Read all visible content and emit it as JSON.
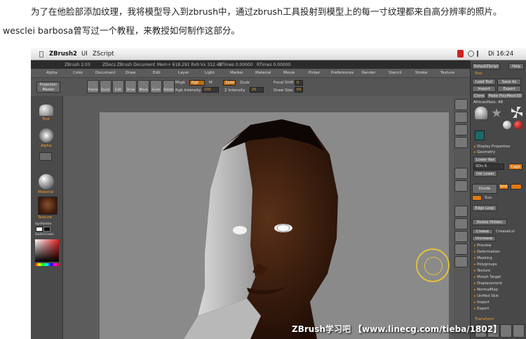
{
  "article": {
    "line1": "为了在他脸部添加纹理，我将模型导入到zbrush中，通过zbrush工具投射到模型上的每一寸纹理都来自高分辨率的照片。",
    "line2": "wesclei barbosa曾写过一个教程，来教授如何制作这部分。"
  },
  "macbar": {
    "app": "ZBrush2",
    "menu_ui": "UI",
    "menu_zscript": "ZScript",
    "clock": "Di 16:24"
  },
  "zbrush_header": {
    "title": "ZBrush 2.03",
    "doc": "ZDocs ZBrush Document",
    "mem": "Mem+ 618.291 Rx9 Vx 312.49",
    "ztimes": "ZTimes 0.00000",
    "rtimes": "RTimes 0.00000"
  },
  "menus": [
    "Alpha",
    "Color",
    "Document",
    "Draw",
    "Edit",
    "Layer",
    "Light",
    "Marker",
    "Material",
    "Movie",
    "Picker",
    "Preferences",
    "Render",
    "Stencil",
    "Stroke",
    "Texture"
  ],
  "toolbar": {
    "projection_master": "Projection Master",
    "tools": [
      "Frame",
      "Quick",
      "Edit",
      "Draw",
      "Move",
      "Scale",
      "Rotate"
    ],
    "mrgb": "Mrgb",
    "rgb": "Rgb",
    "m": "M",
    "rgb_intensity_label": "Rgb Intensity",
    "rgb_intensity": "100",
    "zadd": "Zadd",
    "zsub": "Zsub",
    "z_intensity_label": "Z Intensity",
    "z_intensity": "25",
    "focal_shift_label": "Focal Shift",
    "focal_shift": "0",
    "draw_size_label": "Draw Size",
    "draw_size": "64"
  },
  "left_panel": {
    "tool": "Tool",
    "alpha": "Alpha",
    "material": "Material",
    "texture": "Texture",
    "syspalette": "SysPalette",
    "switchcolor": "SwitchColor"
  },
  "right_tools": [
    "Scroll",
    "Zoom",
    "Actual",
    "AAHalf",
    "Pf Sur",
    "Local",
    "Move",
    "Scale",
    "Rotate",
    "Spin"
  ],
  "right_panel": {
    "tool_header": "Tool",
    "load_tool": "Load Tool",
    "save_as": "Save As",
    "import": "Import",
    "export": "Export",
    "clone": "Clone",
    "make_polymesh": "Make PolyMesh3D",
    "current_tool": "AfricanHalo. 48",
    "items_top": [
      "Display Properties",
      "Geometry"
    ],
    "lower_res": "Lower Res",
    "sdiv": "SDiv 6",
    "cage": "Cage",
    "del_lower": "Del Lower",
    "divide": "Divide",
    "smt": "Smt",
    "suv": "Suv",
    "edge_loop": "Edge Loop",
    "delete_hidden": "Delete Hidden",
    "crease": "Crease",
    "creaselvl": "CreaseLvl",
    "uncrease": "Uncrease",
    "items_bottom": [
      "Preview",
      "Deformation",
      "Masking",
      "Polygroups",
      "Texture",
      "Morph Target",
      "Displacement",
      "NormalMap",
      "Unified Skin",
      "Import",
      "Export"
    ],
    "transform": "Transform",
    "ui_btn": "DefaultZScript",
    "help": "Help"
  },
  "watermark": "ZBrush学习吧 【www.linecg.com/tieba/1802】",
  "colors": {
    "accent": "#e07a12"
  }
}
